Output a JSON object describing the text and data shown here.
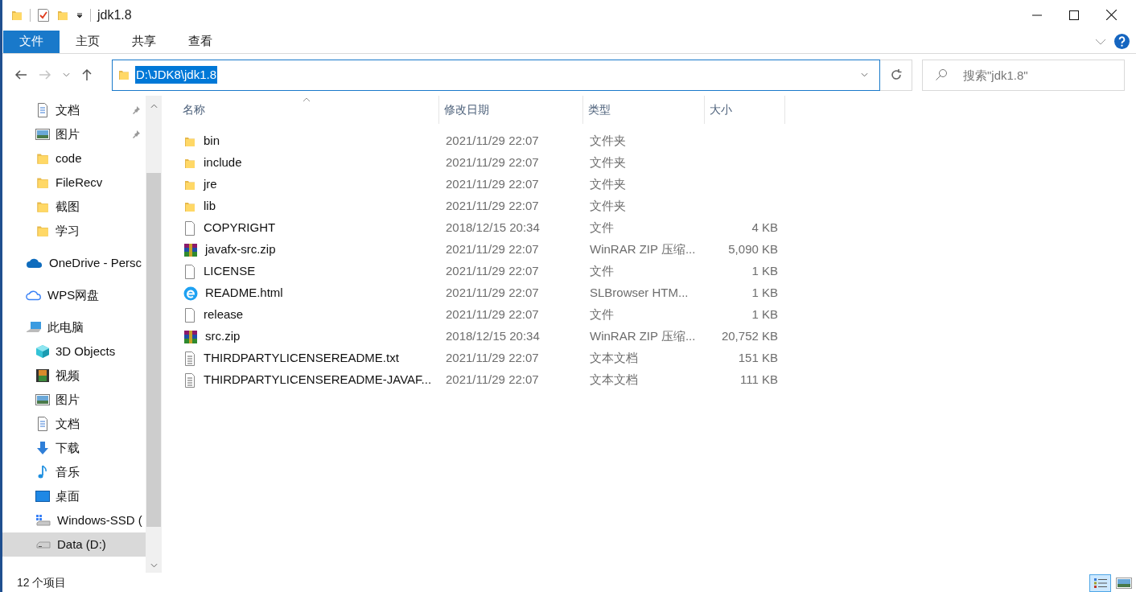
{
  "window": {
    "title": "jdk1.8"
  },
  "ribbon_tabs": [
    {
      "label": "文件",
      "selected": true
    },
    {
      "label": "主页",
      "selected": false
    },
    {
      "label": "共享",
      "selected": false
    },
    {
      "label": "查看",
      "selected": false
    }
  ],
  "address": {
    "path": "D:\\JDK8\\jdk1.8"
  },
  "search": {
    "placeholder": "搜索\"jdk1.8\""
  },
  "sidebar": {
    "quick_access": [
      {
        "label": "文档",
        "kind": "document",
        "pinned": true,
        "selected": false
      },
      {
        "label": "图片",
        "kind": "picture",
        "pinned": true,
        "selected": false
      },
      {
        "label": "code",
        "kind": "folder",
        "pinned": false,
        "selected": false
      },
      {
        "label": "FileRecv",
        "kind": "folder",
        "pinned": false,
        "selected": false
      },
      {
        "label": "截图",
        "kind": "folder",
        "pinned": false,
        "selected": false
      },
      {
        "label": "学习",
        "kind": "folder",
        "pinned": false,
        "selected": false
      }
    ],
    "items": [
      {
        "label": "OneDrive - Persc",
        "kind": "onedrive",
        "selected": false
      },
      {
        "label": "WPS网盘",
        "kind": "cloud",
        "selected": false
      },
      {
        "label": "此电脑",
        "kind": "pc",
        "selected": false,
        "children": [
          {
            "label": "3D Objects",
            "kind": "cube",
            "selected": false
          },
          {
            "label": "视频",
            "kind": "video",
            "selected": false
          },
          {
            "label": "图片",
            "kind": "picture",
            "selected": false
          },
          {
            "label": "文档",
            "kind": "document",
            "selected": false
          },
          {
            "label": "下载",
            "kind": "download",
            "selected": false
          },
          {
            "label": "音乐",
            "kind": "music",
            "selected": false
          },
          {
            "label": "桌面",
            "kind": "desktop",
            "selected": false
          },
          {
            "label": "Windows-SSD (",
            "kind": "system-drive",
            "selected": false
          },
          {
            "label": "Data (D:)",
            "kind": "drive",
            "selected": true
          }
        ]
      }
    ]
  },
  "table": {
    "columns": [
      "名称",
      "修改日期",
      "类型",
      "大小"
    ],
    "rows": [
      {
        "name": "bin",
        "kind": "folder",
        "date": "2021/11/29 22:07",
        "type": "文件夹"
      },
      {
        "name": "include",
        "kind": "folder",
        "date": "2021/11/29 22:07",
        "type": "文件夹"
      },
      {
        "name": "jre",
        "kind": "folder",
        "date": "2021/11/29 22:07",
        "type": "文件夹"
      },
      {
        "name": "lib",
        "kind": "folder",
        "date": "2021/11/29 22:07",
        "type": "文件夹"
      },
      {
        "name": "COPYRIGHT",
        "kind": "file",
        "date": "2018/12/15 20:34",
        "type": "文件",
        "size": "4 KB"
      },
      {
        "name": "javafx-src.zip",
        "kind": "archive",
        "date": "2021/11/29 22:07",
        "type": "WinRAR ZIP 压缩...",
        "size": "5,090 KB"
      },
      {
        "name": "LICENSE",
        "kind": "file",
        "date": "2021/11/29 22:07",
        "type": "文件",
        "size": "1 KB"
      },
      {
        "name": "README.html",
        "kind": "browser",
        "date": "2021/11/29 22:07",
        "type": "SLBrowser HTM...",
        "size": "1 KB"
      },
      {
        "name": "release",
        "kind": "file",
        "date": "2021/11/29 22:07",
        "type": "文件",
        "size": "1 KB"
      },
      {
        "name": "src.zip",
        "kind": "archive",
        "date": "2018/12/15 20:34",
        "type": "WinRAR ZIP 压缩...",
        "size": "20,752 KB"
      },
      {
        "name": "THIRDPARTYLICENSEREADME.txt",
        "kind": "text",
        "date": "2021/11/29 22:07",
        "type": "文本文档",
        "size": "151 KB"
      },
      {
        "name": "THIRDPARTYLICENSEREADME-JAVAF...",
        "kind": "text",
        "date": "2021/11/29 22:07",
        "type": "文本文档",
        "size": "111 KB"
      }
    ]
  },
  "status_bar": {
    "count": "12 个项目",
    "views": [
      {
        "kind": "details",
        "selected": true
      },
      {
        "kind": "large-icons",
        "selected": false
      }
    ]
  }
}
